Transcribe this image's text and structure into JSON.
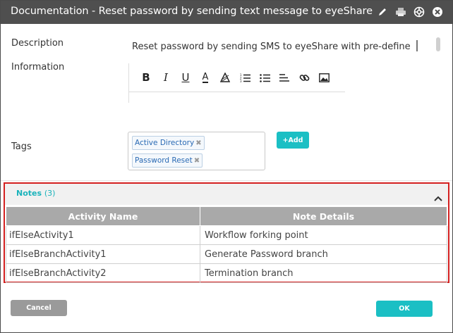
{
  "window": {
    "title": "Documentation - Reset password by sending text message to eyeShare",
    "icons": [
      "pencil-icon",
      "printer-icon",
      "settings-icon",
      "close-icon"
    ]
  },
  "form": {
    "description_label": "Description",
    "description_value": "Reset password by sending SMS to eyeShare with pre-define",
    "information_label": "Information",
    "editor_tools": [
      "bold-icon",
      "italic-icon",
      "underline-icon",
      "font-color-icon",
      "highlight-icon",
      "ordered-list-icon",
      "unordered-list-icon",
      "align-icon",
      "link-icon",
      "image-icon"
    ],
    "editor_glyphs": {
      "bold": "B",
      "italic": "I",
      "underline": "U",
      "font_color": "A"
    },
    "tags_label": "Tags",
    "tags": [
      {
        "label": "Active Directory",
        "remove": "✖"
      },
      {
        "label": "Password Reset",
        "remove": "✖"
      }
    ],
    "add_button": "+Add"
  },
  "notes": {
    "title": "Notes",
    "count": "(3)",
    "columns": [
      "Activity Name",
      "Note Details"
    ],
    "rows": [
      [
        "ifElseActivity1",
        "Workflow forking point"
      ],
      [
        "ifElseBranchActivity1",
        "Generate Password branch"
      ],
      [
        "ifElseBranchActivity2",
        "Termination branch"
      ]
    ]
  },
  "footer": {
    "cancel_label": "Cancel",
    "ok_label": "OK"
  },
  "colors": {
    "titlebar": "#4f4f4f",
    "accent": "#1bbfc4",
    "notes_border": "#d42020",
    "table_header": "#a9a9a9"
  }
}
